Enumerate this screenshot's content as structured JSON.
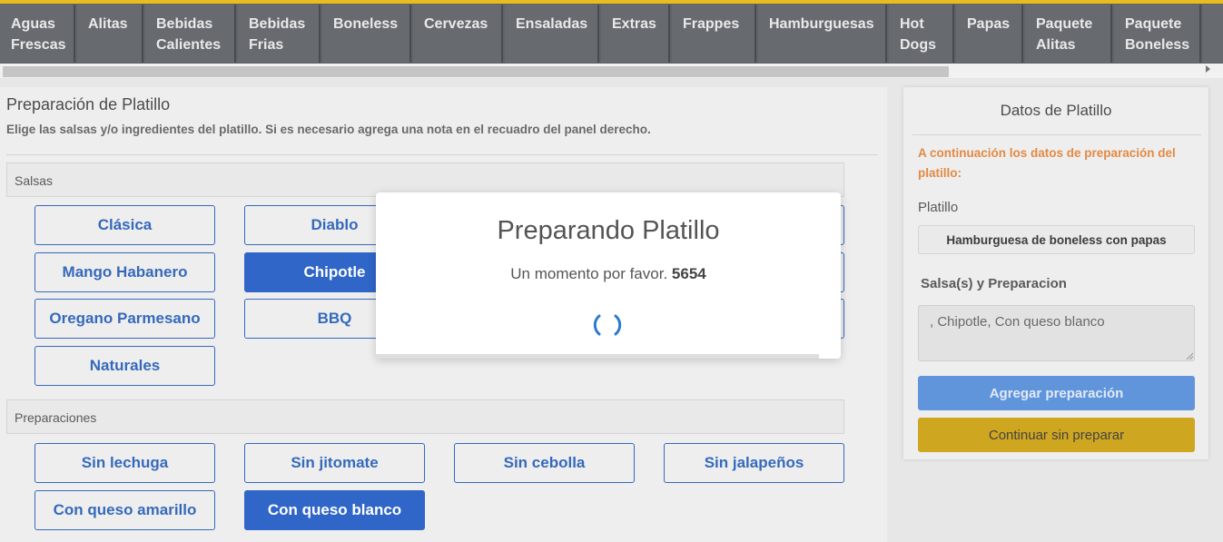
{
  "categories": [
    {
      "label_line1": "Aguas",
      "label_line2": "Frescas"
    },
    {
      "label_line1": "Alitas",
      "label_line2": ""
    },
    {
      "label_line1": "Bebidas",
      "label_line2": "Calientes"
    },
    {
      "label_line1": "Bebidas",
      "label_line2": "Frias"
    },
    {
      "label_line1": "Boneless",
      "label_line2": ""
    },
    {
      "label_line1": "Cervezas",
      "label_line2": ""
    },
    {
      "label_line1": "Ensaladas",
      "label_line2": ""
    },
    {
      "label_line1": "Extras",
      "label_line2": ""
    },
    {
      "label_line1": "Frappes",
      "label_line2": ""
    },
    {
      "label_line1": "Hamburguesas",
      "label_line2": ""
    },
    {
      "label_line1": "Hot",
      "label_line2": "Dogs"
    },
    {
      "label_line1": "Papas",
      "label_line2": ""
    },
    {
      "label_line1": "Paquete",
      "label_line2": "Alitas"
    },
    {
      "label_line1": "Paquete",
      "label_line2": "Boneless"
    }
  ],
  "main": {
    "title": "Preparación de Platillo",
    "subtitle": "Elige las salsas y/o ingredientes del platillo. Si es necesario agrega una nota en el recuadro del panel derecho.",
    "salsas_header": "Salsas",
    "salsas": [
      {
        "label": "Clásica",
        "selected": false
      },
      {
        "label": "Diablo",
        "selected": false
      },
      {
        "label": "Mango Habanero",
        "selected": false
      },
      {
        "label": "Chipotle",
        "selected": true
      },
      {
        "label": "Oregano Parmesano",
        "selected": false
      },
      {
        "label": "BBQ",
        "selected": false
      },
      {
        "label": "Naturales",
        "selected": false
      }
    ],
    "preparaciones_header": "Preparaciones",
    "preparaciones": [
      {
        "label": "Sin lechuga",
        "selected": false
      },
      {
        "label": "Sin jitomate",
        "selected": false
      },
      {
        "label": "Sin cebolla",
        "selected": false
      },
      {
        "label": "Sin jalapeños",
        "selected": false
      },
      {
        "label": "Con queso amarillo",
        "selected": false
      },
      {
        "label": "Con queso blanco",
        "selected": true
      }
    ]
  },
  "side_panel": {
    "title": "Datos de Platillo",
    "note": "A continuación los datos de preparación del platillo:",
    "dish_label": "Platillo",
    "dish_value": "Hamburguesa de boneless con papas",
    "prep_label": "Salsa(s) y Preparacion",
    "prep_value": ", Chipotle, Con queso blanco",
    "add_button": "Agregar preparación",
    "continue_button": "Continuar sin preparar"
  },
  "modal": {
    "title": "Preparando Platillo",
    "message": "Un momento por favor.",
    "code": "5654"
  },
  "colors": {
    "accent_yellow": "#e8b400",
    "primary_blue": "#1451c0",
    "note_orange": "#e07a2a",
    "category_bar": "#4a4f55"
  }
}
